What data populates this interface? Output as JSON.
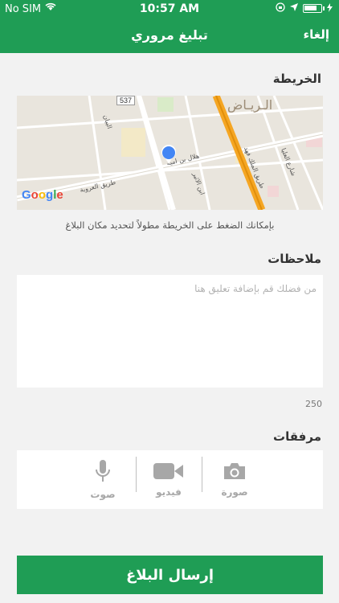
{
  "status_bar": {
    "carrier": "No SIM",
    "time": "10:57 AM",
    "battery_level": 0.8
  },
  "nav": {
    "title": "تبليغ مروري",
    "cancel_label": "إلغاء"
  },
  "map_section": {
    "label": "الخريطة",
    "hint": "بإمكانك الضغط على الخريطة مطولاً لتحديد مكان البلاغ",
    "map_texts": {
      "road_number": "537",
      "city": "الـريـاض",
      "street_1": "هلال بن امية",
      "street_2": "ابن الاثير",
      "street_3": "طريق العروبة",
      "street_4": "طريق الملك فهد",
      "street_5": "شارع العليا",
      "street_6": "البيان",
      "brand": "Google"
    }
  },
  "notes_section": {
    "label": "ملاحظات",
    "placeholder": "من فضلك قم بإضافة تعليق هنا",
    "value": "",
    "remaining_chars": "250"
  },
  "attachments_section": {
    "label": "مرفقات",
    "items": [
      {
        "label": "صورة",
        "icon": "camera-icon"
      },
      {
        "label": "فيديو",
        "icon": "video-camera-icon"
      },
      {
        "label": "صوت",
        "icon": "microphone-icon"
      }
    ]
  },
  "submit": {
    "label": "إرسال البلاغ"
  },
  "colors": {
    "brand_green": "#1f9d55",
    "background": "#f2f2f2",
    "disabled_icon": "#a7a7a7"
  }
}
